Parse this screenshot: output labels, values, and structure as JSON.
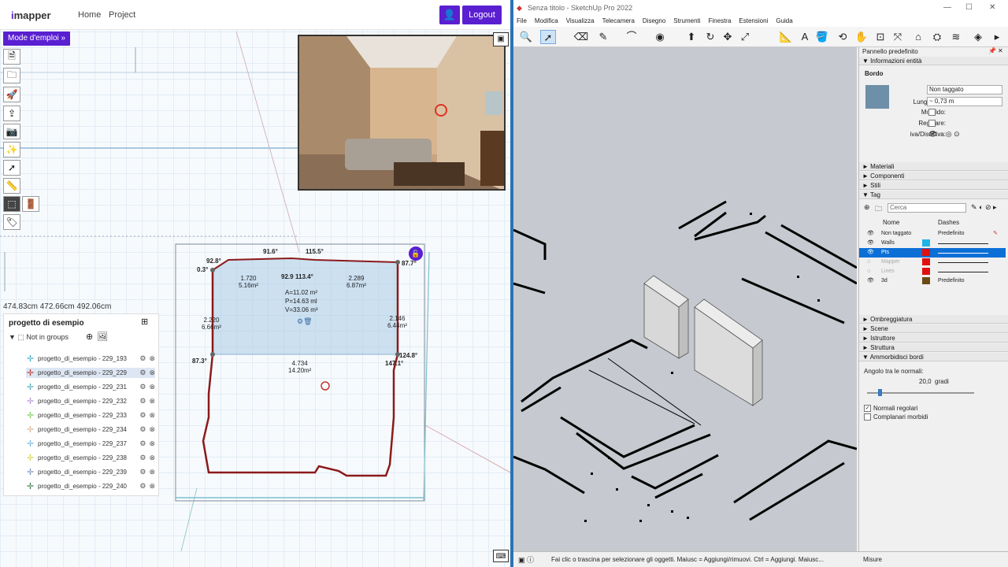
{
  "left_app": {
    "logo_prefix": "i",
    "logo_rest": "mapper",
    "nav": {
      "home": "Home",
      "project": "Project",
      "logout": "Logout"
    },
    "mode_button": "Mode d'emploi »",
    "measure_readout": "474.83cm 472.66cm 492.06cm",
    "plan_labels": {
      "a1": "92.8°",
      "a2": "0.3°",
      "a3": "91.6°",
      "a4": "115.5°",
      "a5": "87.7°",
      "a6": "92.9",
      "a7": "113.4°",
      "a8": "87.3°",
      "a9": "124.8°",
      "a10": "147.1°",
      "d1": "1.720",
      "d1a": "5.16m²",
      "d2": "2.289",
      "d2a": "6.87m²",
      "d3": "2.220",
      "d3a": "6.66m²",
      "d4": "2.146",
      "d4a": "6.44m²",
      "d5": "4.734",
      "d5a": "14.20m²",
      "area": "A=11.02 m²",
      "perimeter": "P=14.63 ml",
      "volume": "V=33.06 m³"
    },
    "panel": {
      "title": "progetto di esempio",
      "group": "Not in groups",
      "items": [
        {
          "label": "progetto_di_esempio - 229_193",
          "color": "#3cb0c8"
        },
        {
          "label": "progetto_di_esempio - 229_229",
          "color": "#c0392b"
        },
        {
          "label": "progetto_di_esempio - 229_231",
          "color": "#4aa8b8"
        },
        {
          "label": "progetto_di_esempio - 229_232",
          "color": "#b38fd6"
        },
        {
          "label": "progetto_di_esempio - 229_233",
          "color": "#7dcc55"
        },
        {
          "label": "progetto_di_esempio - 229_234",
          "color": "#d9b48f"
        },
        {
          "label": "progetto_di_esempio - 229_237",
          "color": "#6fb8e0"
        },
        {
          "label": "progetto_di_esempio - 229_238",
          "color": "#d6d24a"
        },
        {
          "label": "progetto_di_esempio - 229_239",
          "color": "#7a8fc0"
        },
        {
          "label": "progetto_di_esempio - 229_240",
          "color": "#3d7a4a"
        }
      ]
    }
  },
  "sketchup": {
    "title": "Senza titolo - SketchUp Pro 2022",
    "menu": [
      "File",
      "Modifica",
      "Visualizza",
      "Telecamera",
      "Disegno",
      "Strumenti",
      "Finestra",
      "Estensioni",
      "Guida"
    ],
    "tray_title": "Pannello predefinito",
    "entity": {
      "section": "Informazioni entità",
      "type": "Bordo",
      "tag_label": "Tag:",
      "tag_value": "Non taggato",
      "length_label": "Lunghezza:",
      "length_value": "~ 0,73 m",
      "soft_label": "Morbido:",
      "smooth_label": "Regolare:",
      "toggle_label": "iva/Disattiva:"
    },
    "sections": {
      "materials": "Materiali",
      "components": "Componenti",
      "styles": "Stili",
      "tags": "Tag",
      "shadows": "Ombreggiatura",
      "scenes": "Scene",
      "instructor": "Istruttore",
      "structure": "Struttura",
      "soften": "Ammorbidisci bordi"
    },
    "tags": {
      "search_placeholder": "Cerca",
      "col_name": "Nome",
      "col_dashes": "Dashes",
      "rows": [
        {
          "name": "Non taggato",
          "dash": "Predefinito",
          "color": ""
        },
        {
          "name": "Walls",
          "dash": "",
          "color": "#1fb3e6"
        },
        {
          "name": "Pts",
          "dash": "",
          "color": "#e01010"
        },
        {
          "name": "Mapper",
          "dash": "",
          "color": "#e01010"
        },
        {
          "name": "Lines",
          "dash": "",
          "color": "#e01010"
        },
        {
          "name": "3d",
          "dash": "Predefinito",
          "color": "#6b4a16"
        }
      ]
    },
    "soften": {
      "angle_label": "Angolo tra le normali:",
      "angle_value": "20,0",
      "angle_unit": "gradi",
      "normals": "Normali regolari",
      "coplanar": "Complanari morbidi"
    },
    "status_text": "Fai clic o trascina per selezionare gli oggetti. Maiusc = Aggiungi/rimuovi. Ctrl = Aggiungi. Maiusc...",
    "measures": "Misure"
  }
}
